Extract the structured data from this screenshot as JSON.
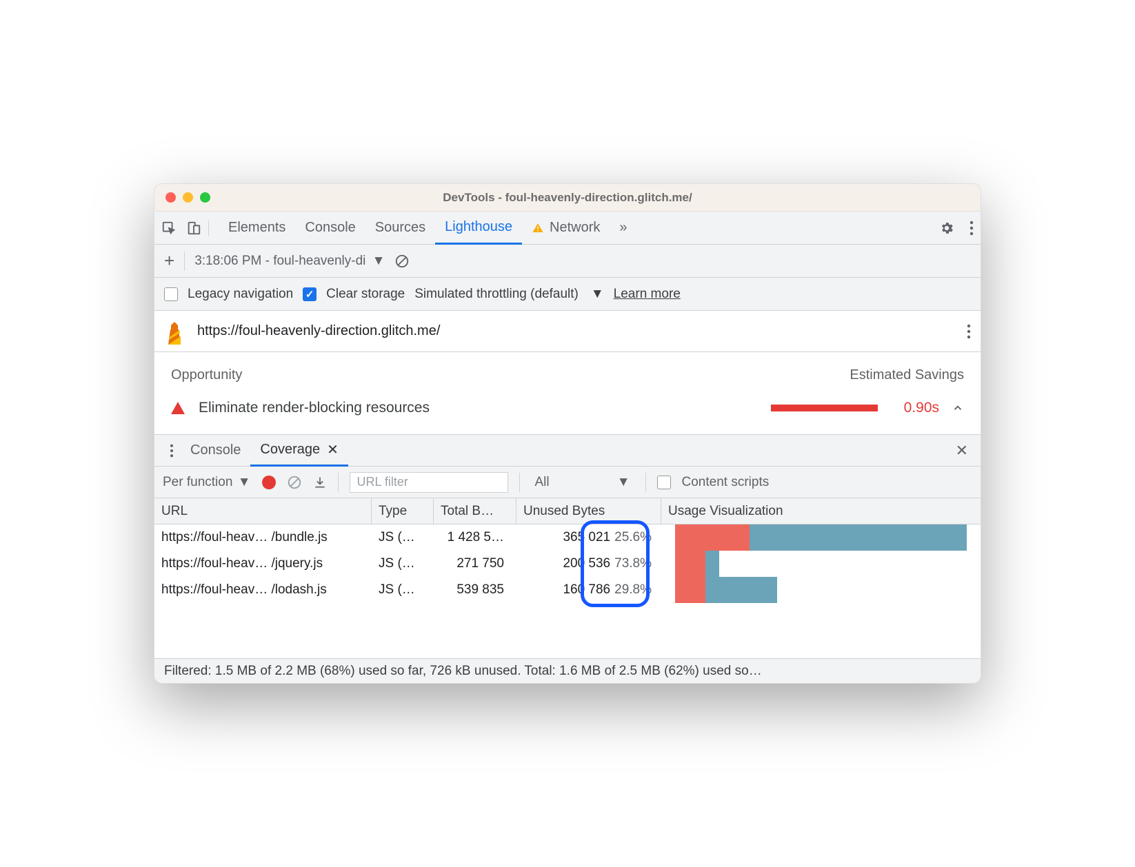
{
  "window": {
    "title": "DevTools - foul-heavenly-direction.glitch.me/"
  },
  "tabs": {
    "items": [
      "Elements",
      "Console",
      "Sources",
      "Lighthouse",
      "Network"
    ],
    "active": "Lighthouse",
    "overflow": "»"
  },
  "lighthouse_toolbar": {
    "run_label": "3:18:06 PM - foul-heavenly-di",
    "legacy_label": "Legacy navigation",
    "clear_label": "Clear storage",
    "throttling_label": "Simulated throttling (default)",
    "learn_more": "Learn more"
  },
  "report": {
    "url": "https://foul-heavenly-direction.glitch.me/",
    "opportunity_header": "Opportunity",
    "savings_header": "Estimated Savings",
    "item": {
      "title": "Eliminate render-blocking resources",
      "value": "0.90s"
    }
  },
  "drawer": {
    "console_tab": "Console",
    "coverage_tab": "Coverage"
  },
  "coverage": {
    "mode": "Per function",
    "url_filter_placeholder": "URL filter",
    "type_filter": "All",
    "content_scripts_label": "Content scripts",
    "columns": {
      "url": "URL",
      "type": "Type",
      "total": "Total B…",
      "unused": "Unused Bytes",
      "viz": "Usage Visualization"
    },
    "rows": [
      {
        "url": "https://foul-heav… /bundle.js",
        "type": "JS (…",
        "total": "1 428 5…",
        "unused_bytes": "365 021",
        "unused_pct": "25.6%",
        "viz_unused": 25.6,
        "viz_width": 100
      },
      {
        "url": "https://foul-heav… /jquery.js",
        "type": "JS (…",
        "total": "271 750",
        "unused_bytes": "200 536",
        "unused_pct": "73.8%",
        "viz_unused": 73.8,
        "viz_width": 19
      },
      {
        "url": "https://foul-heav… /lodash.js",
        "type": "JS (…",
        "total": "539 835",
        "unused_bytes": "160 786",
        "unused_pct": "29.8%",
        "viz_unused": 29.8,
        "viz_width": 38
      }
    ],
    "status": "Filtered: 1.5 MB of 2.2 MB (68%) used so far, 726 kB unused. Total: 1.6 MB of 2.5 MB (62%) used so…"
  }
}
